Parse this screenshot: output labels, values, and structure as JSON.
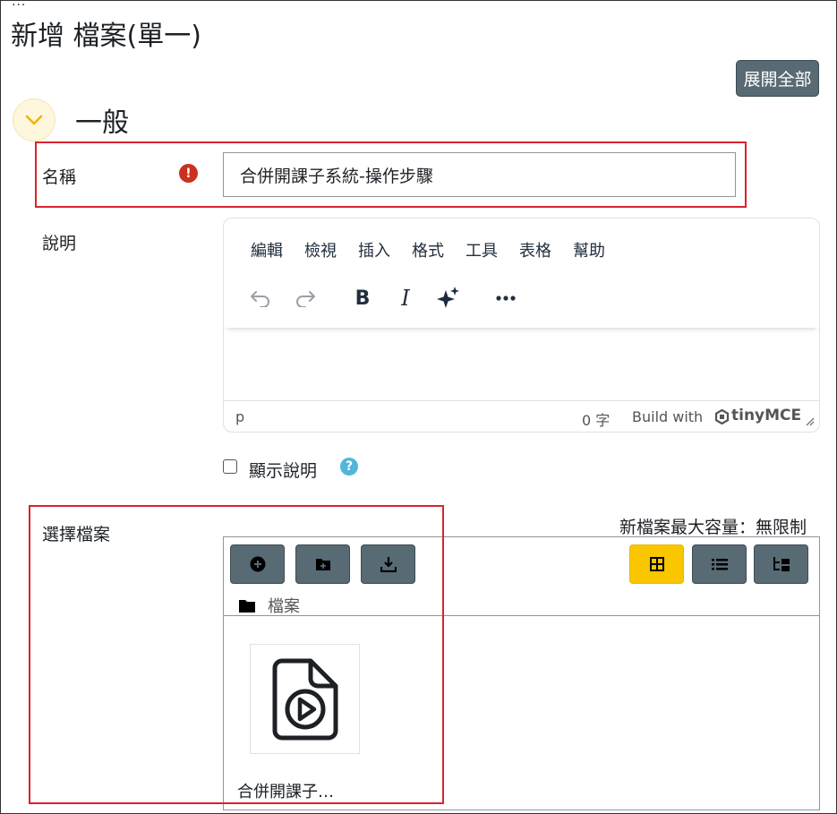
{
  "header": {
    "ellipsis": "...",
    "title": "新增 檔案(單一)",
    "expand_all": "展開全部"
  },
  "section": {
    "title": "一般"
  },
  "form": {
    "name_label": "名稱",
    "name_required_mark": "!",
    "name_value": "合併開課子系統-操作步驟",
    "description_label": "說明",
    "show_description_label": "顯示說明",
    "show_description_checked": false,
    "help_mark": "?",
    "select_files_label": "選擇檔案",
    "max_size_text": "新檔案最大容量：無限制"
  },
  "editor": {
    "menu": [
      "編輯",
      "檢視",
      "插入",
      "格式",
      "工具",
      "表格",
      "幫助"
    ],
    "toolbar_icons": [
      "undo-icon",
      "redo-icon",
      "bold-icon",
      "italic-icon",
      "ai-sparkle-icon",
      "more-icon"
    ],
    "bold_glyph": "B",
    "italic_glyph": "I",
    "status_path": "p",
    "word_count": "0 字",
    "build_with": "Build with",
    "brand": "tinyMCE"
  },
  "file_manager": {
    "breadcrumb": "檔案",
    "view_modes": [
      "grid",
      "list",
      "tree"
    ],
    "active_view": "grid",
    "files": [
      {
        "name": "合併開課子…",
        "icon": "video-file-icon"
      }
    ]
  },
  "colors": {
    "accent_button": "#586a73",
    "active_view": "#f9c600",
    "required": "#ca3120",
    "help": "#52b6d9",
    "annotation": "#d9232d"
  }
}
